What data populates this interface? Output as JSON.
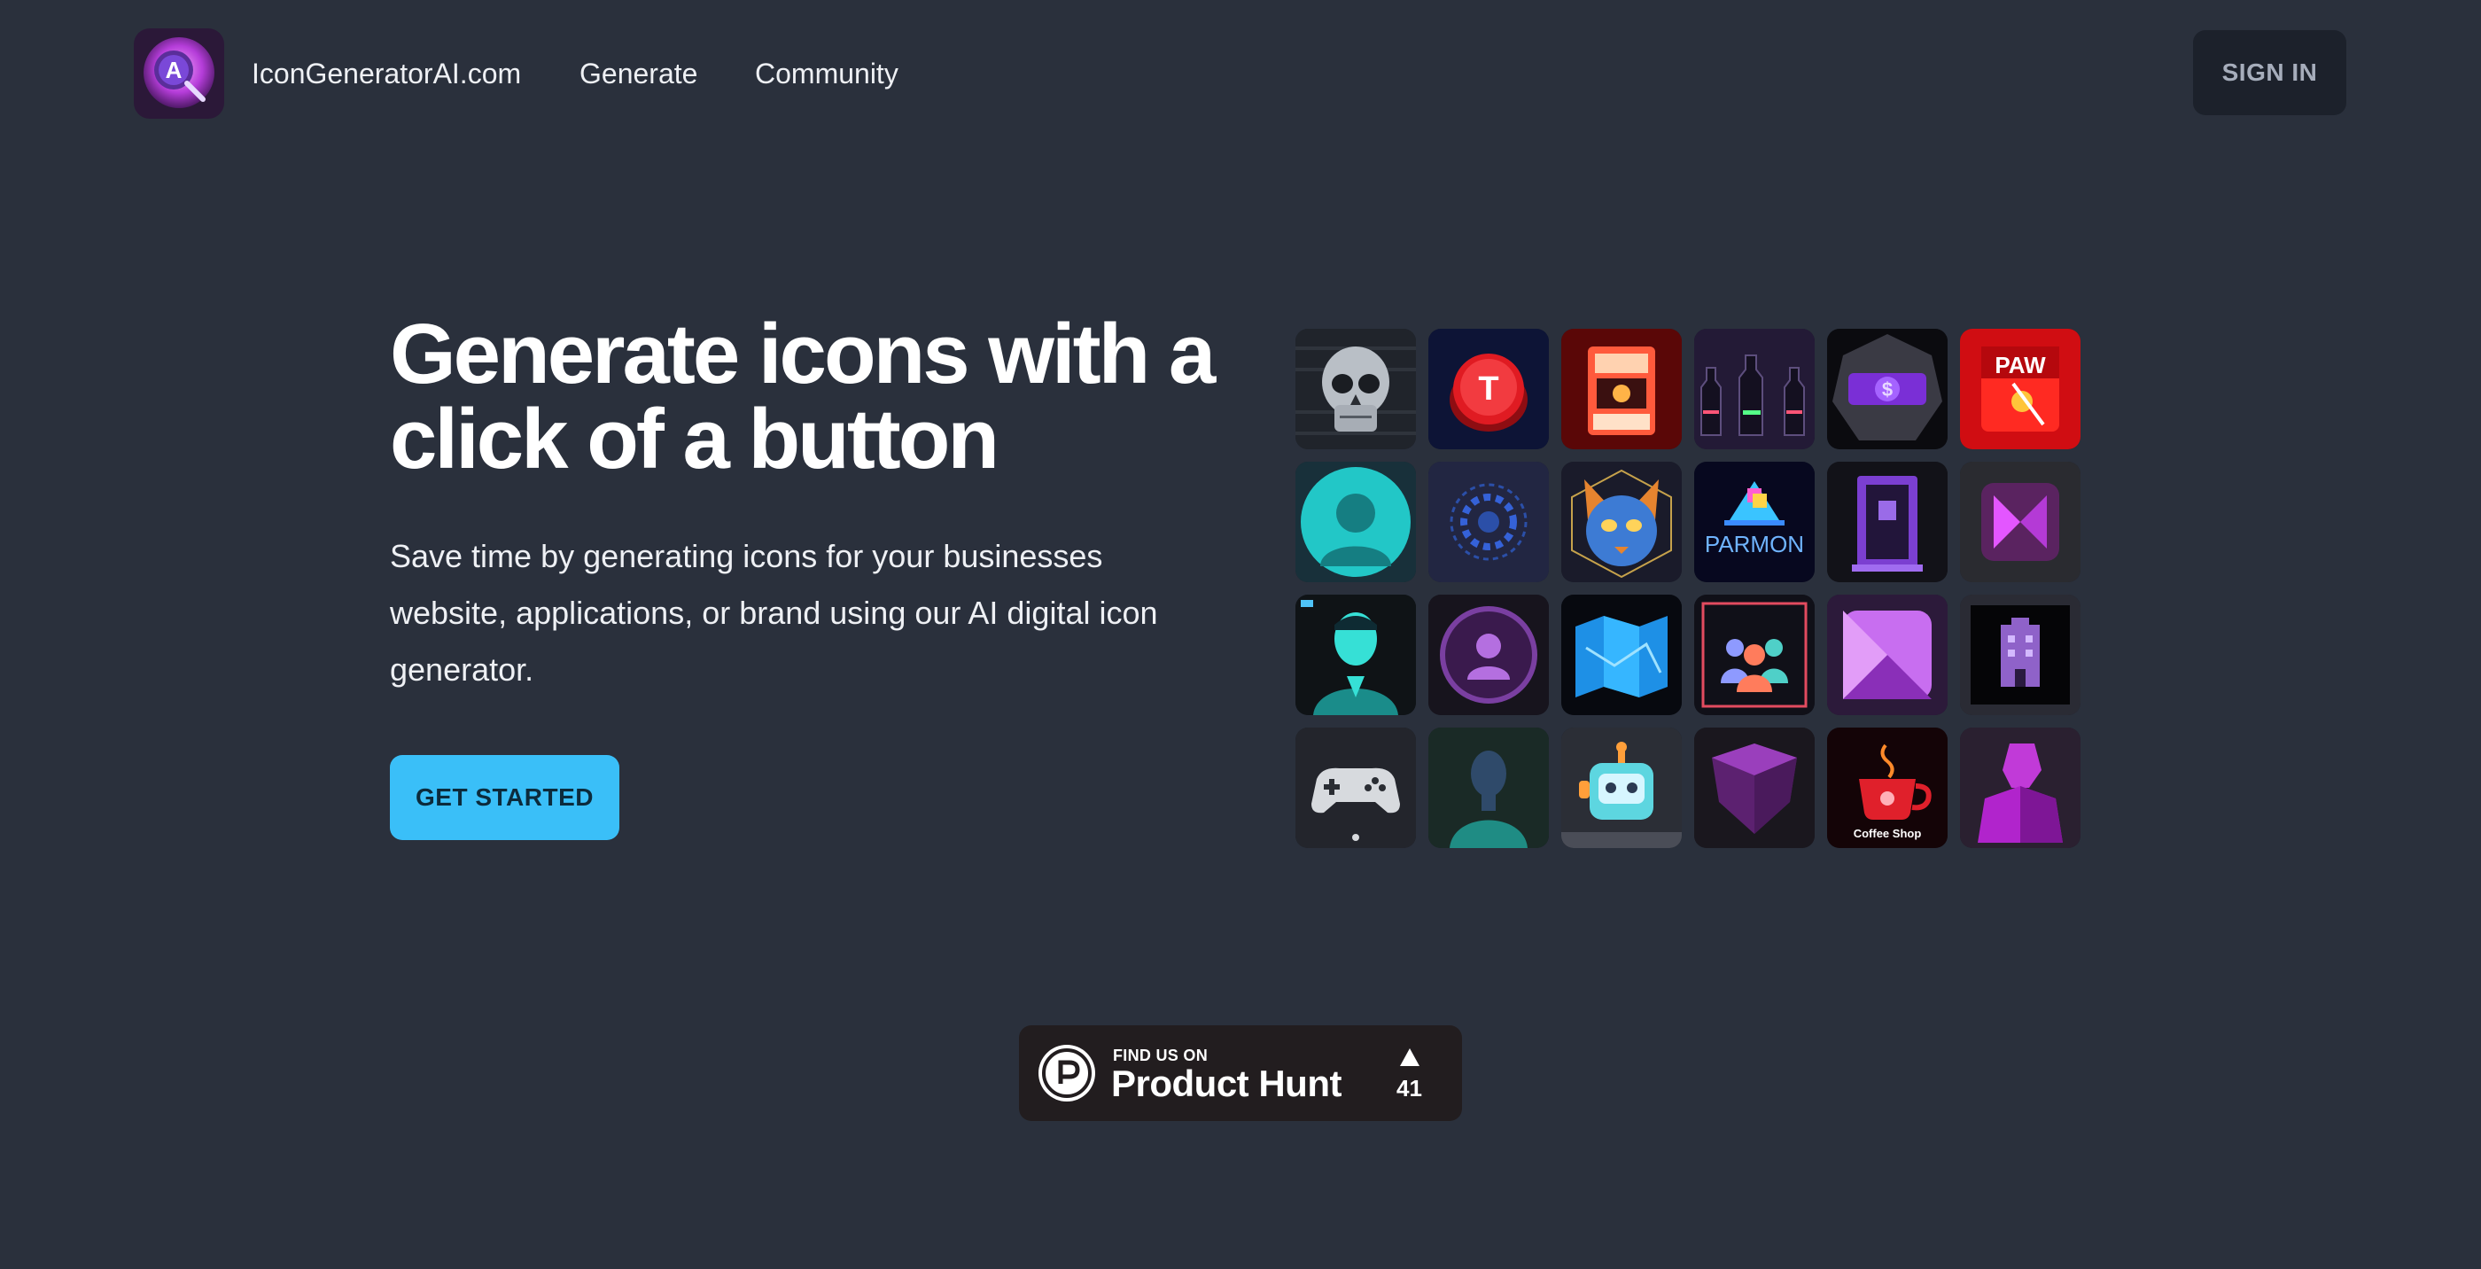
{
  "header": {
    "brand": "IconGeneratorAI.com",
    "nav": [
      "Generate",
      "Community"
    ],
    "signin_label": "SIGN IN"
  },
  "hero": {
    "title": "Generate icons with a click of a button",
    "description": "Save time by generating icons for your businesses website, applications, or brand using our AI digital icon generator.",
    "cta_label": "GET STARTED"
  },
  "gallery": {
    "tiles": [
      {
        "name": "skull-icon"
      },
      {
        "name": "red-t-button-icon",
        "text": "T"
      },
      {
        "name": "red-arcade-machine-icon"
      },
      {
        "name": "bottles-icon"
      },
      {
        "name": "purple-dollar-icon",
        "text": "$"
      },
      {
        "name": "paw-sign-icon",
        "text": "PAW"
      },
      {
        "name": "teal-person-icon"
      },
      {
        "name": "blue-gear-icon"
      },
      {
        "name": "cat-face-icon"
      },
      {
        "name": "parmon-logo-icon",
        "text": "PARMON"
      },
      {
        "name": "purple-door-icon"
      },
      {
        "name": "purple-diamond-icon"
      },
      {
        "name": "teal-man-portrait-icon"
      },
      {
        "name": "purple-profile-icon"
      },
      {
        "name": "blue-map-icon"
      },
      {
        "name": "people-group-icon"
      },
      {
        "name": "purple-square-icon"
      },
      {
        "name": "purple-building-icon"
      },
      {
        "name": "gamepad-icon"
      },
      {
        "name": "dark-person-icon"
      },
      {
        "name": "robot-icon"
      },
      {
        "name": "purple-shield-icon"
      },
      {
        "name": "coffee-shop-icon",
        "text": "Coffee Shop"
      },
      {
        "name": "purple-bust-icon"
      }
    ]
  },
  "producthunt": {
    "find_label": "FIND US ON",
    "name": "Product Hunt",
    "upvotes": "41"
  },
  "colors": {
    "background": "#2a303c",
    "primary": "#3abff8",
    "button_dark": "#1c212b",
    "ph_badge": "#221d1f"
  }
}
